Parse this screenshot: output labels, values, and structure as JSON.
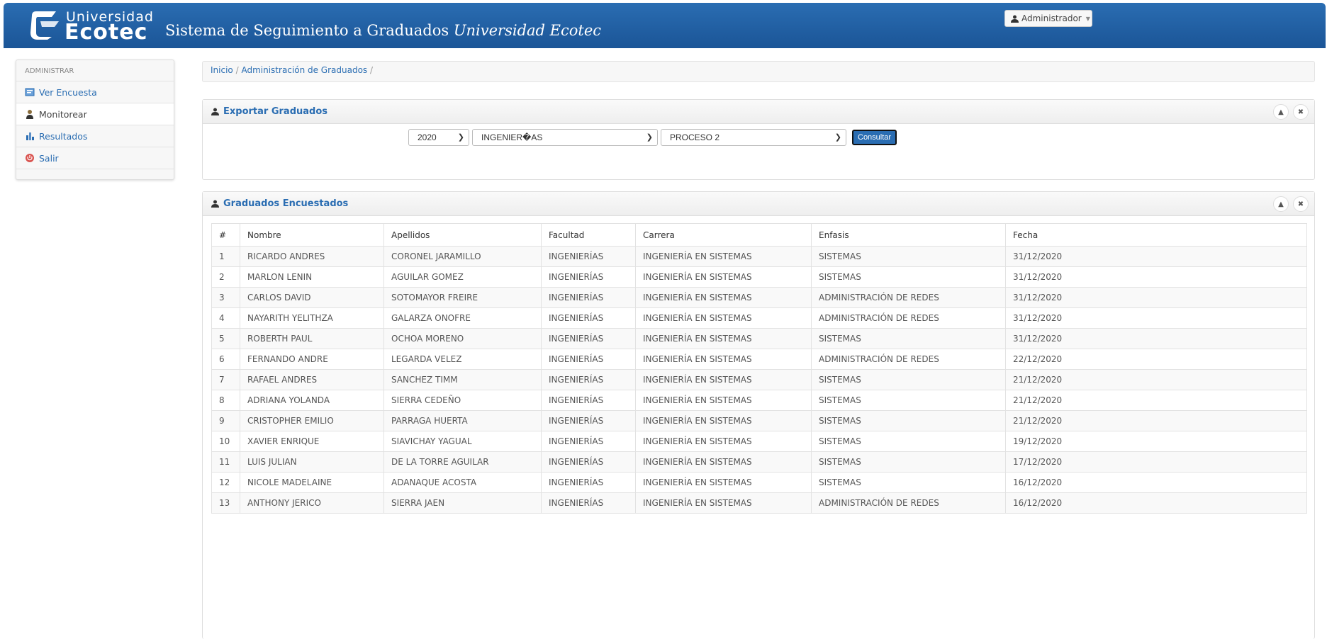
{
  "header": {
    "brand_small": "Universidad",
    "brand_big": "Ecotec",
    "title_main": "Sistema de Seguimiento a Graduados",
    "title_italic": "Universidad Ecotec",
    "user_menu": "Administrador",
    "colors": {
      "header_bg": "#1f5c9e",
      "accent": "#2a6db2"
    }
  },
  "sidebar": {
    "section": "ADMINISTRAR",
    "items": [
      {
        "label": "Ver Encuesta",
        "icon": "survey-icon"
      },
      {
        "label": "Monitorear",
        "icon": "user-tie-icon"
      },
      {
        "label": "Resultados",
        "icon": "bar-chart-icon"
      },
      {
        "label": "Salir",
        "icon": "power-icon"
      }
    ]
  },
  "breadcrumb": {
    "home": "Inicio",
    "sep": "/",
    "current": "Administración de Graduados",
    "trail_end": "/"
  },
  "export_panel": {
    "title": "Exportar Graduados",
    "year": "2020",
    "faculty": "INGENIER�AS",
    "process": "PROCESO 2",
    "submit": "Consultar"
  },
  "graduates_panel": {
    "title": "Graduados Encuestados",
    "columns": [
      "#",
      "Nombre",
      "Apellidos",
      "Facultad",
      "Carrera",
      "Enfasis",
      "Fecha"
    ],
    "rows": [
      [
        "1",
        "RICARDO ANDRES",
        "CORONEL JARAMILLO",
        "INGENIERÍAS",
        "INGENIERÍA EN SISTEMAS",
        "SISTEMAS",
        "31/12/2020"
      ],
      [
        "2",
        "MARLON LENIN",
        "AGUILAR GOMEZ",
        "INGENIERÍAS",
        "INGENIERÍA EN SISTEMAS",
        "SISTEMAS",
        "31/12/2020"
      ],
      [
        "3",
        "CARLOS DAVID",
        "SOTOMAYOR FREIRE",
        "INGENIERÍAS",
        "INGENIERÍA EN SISTEMAS",
        "ADMINISTRACIÓN DE REDES",
        "31/12/2020"
      ],
      [
        "4",
        "NAYARITH YELITHZA",
        "GALARZA ONOFRE",
        "INGENIERÍAS",
        "INGENIERÍA EN SISTEMAS",
        "ADMINISTRACIÓN DE REDES",
        "31/12/2020"
      ],
      [
        "5",
        "ROBERTH PAUL",
        "OCHOA MORENO",
        "INGENIERÍAS",
        "INGENIERÍA EN SISTEMAS",
        "SISTEMAS",
        "31/12/2020"
      ],
      [
        "6",
        "FERNANDO ANDRE",
        "LEGARDA VELEZ",
        "INGENIERÍAS",
        "INGENIERÍA EN SISTEMAS",
        "ADMINISTRACIÓN DE REDES",
        "22/12/2020"
      ],
      [
        "7",
        "RAFAEL ANDRES",
        "SANCHEZ TIMM",
        "INGENIERÍAS",
        "INGENIERÍA EN SISTEMAS",
        "SISTEMAS",
        "21/12/2020"
      ],
      [
        "8",
        "ADRIANA YOLANDA",
        "SIERRA CEDEÑO",
        "INGENIERÍAS",
        "INGENIERÍA EN SISTEMAS",
        "SISTEMAS",
        "21/12/2020"
      ],
      [
        "9",
        "CRISTOPHER EMILIO",
        "PARRAGA HUERTA",
        "INGENIERÍAS",
        "INGENIERÍA EN SISTEMAS",
        "SISTEMAS",
        "21/12/2020"
      ],
      [
        "10",
        "XAVIER ENRIQUE",
        "SIAVICHAY YAGUAL",
        "INGENIERÍAS",
        "INGENIERÍA EN SISTEMAS",
        "SISTEMAS",
        "19/12/2020"
      ],
      [
        "11",
        "LUIS JULIAN",
        "DE LA TORRE AGUILAR",
        "INGENIERÍAS",
        "INGENIERÍA EN SISTEMAS",
        "SISTEMAS",
        "17/12/2020"
      ],
      [
        "12",
        "NICOLE MADELAINE",
        "ADANAQUE ACOSTA",
        "INGENIERÍAS",
        "INGENIERÍA EN SISTEMAS",
        "SISTEMAS",
        "16/12/2020"
      ],
      [
        "13",
        "ANTHONY JERICO",
        "SIERRA JAEN",
        "INGENIERÍAS",
        "INGENIERÍA EN SISTEMAS",
        "ADMINISTRACIÓN DE REDES",
        "16/12/2020"
      ]
    ]
  }
}
